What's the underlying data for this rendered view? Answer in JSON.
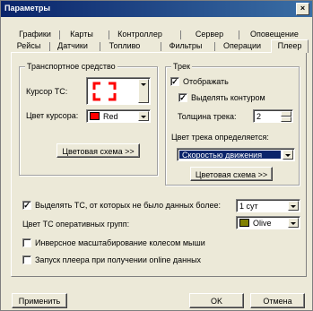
{
  "window": {
    "title": "Параметры",
    "close_glyph": "×"
  },
  "tabs": {
    "row1": [
      "Графики",
      "Карты",
      "Контроллер",
      "Сервер",
      "Оповещение"
    ],
    "row2": [
      "Рейсы",
      "Датчики",
      "Топливо",
      "Фильтры",
      "Операции",
      "Плеер"
    ],
    "active": "Плеер"
  },
  "vehicle_group": {
    "title": "Транспортное средство",
    "cursor_label": "Курсор ТС:",
    "cursor_color_label": "Цвет курсора:",
    "cursor_color_value": "Red",
    "cursor_color_hex": "#ff0000",
    "color_scheme_button": "Цветовая схема >>"
  },
  "track_group": {
    "title": "Трек",
    "show_label": "Отображать",
    "show_checked": true,
    "outline_label": "Выделять контуром",
    "outline_checked": true,
    "thickness_label": "Толщина трека:",
    "thickness_value": "2",
    "color_defined_label": "Цвет трека определяется:",
    "color_defined_value": "Скоростью движения",
    "color_scheme_button": "Цветовая схема >>"
  },
  "options": {
    "highlight_label": "Выделять ТС, от которых не было данных более:",
    "highlight_checked": true,
    "highlight_value": "1 сут",
    "group_color_label": "Цвет ТС оперативных групп:",
    "group_color_value": "Olive",
    "group_color_hex": "#808000",
    "inverse_scale_label": "Инверсное масштабирование колесом мыши",
    "inverse_scale_checked": false,
    "autostart_label": "Запуск плеера при получении online данных",
    "autostart_checked": false
  },
  "footer": {
    "apply": "Применить",
    "ok": "OK",
    "cancel": "Отмена"
  }
}
